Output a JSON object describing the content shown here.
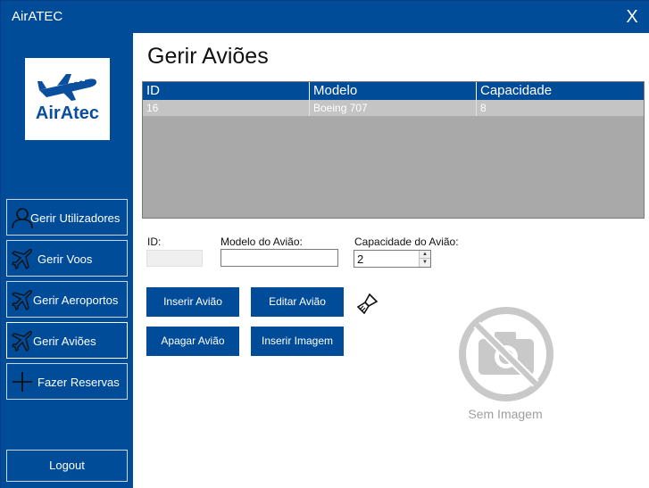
{
  "window": {
    "title": "AirATEC",
    "close_glyph": "X"
  },
  "logo": {
    "text": "AirAtec",
    "icon": "airplane-icon"
  },
  "sidebar": {
    "items": [
      {
        "label": "Gerir Utilizadores",
        "icon": "user-icon"
      },
      {
        "label": "Gerir Voos",
        "icon": "airplane-icon"
      },
      {
        "label": "Gerir Aeroportos",
        "icon": "airplane-icon"
      },
      {
        "label": "Gerir Aviões",
        "icon": "airplane-icon",
        "active": true
      },
      {
        "label": "Fazer Reservas",
        "icon": "plus-icon"
      }
    ],
    "logout_label": "Logout"
  },
  "main": {
    "title": "Gerir Aviões",
    "grid": {
      "columns": [
        "ID",
        "Modelo",
        "Capacidade"
      ],
      "rows": [
        [
          "16",
          "Boeing 707",
          "8"
        ]
      ]
    },
    "form": {
      "id_label": "ID:",
      "id_value": "",
      "model_label": "Modelo do Avião:",
      "model_value": "",
      "capacity_label": "Capacidade do Avião:",
      "capacity_value": "2"
    },
    "buttons": {
      "insert": "Inserir Avião",
      "edit": "Editar Avião",
      "delete": "Apagar Avião",
      "insert_image": "Inserir Imagem"
    },
    "image_placeholder": {
      "label": "Sem Imagem",
      "icon": "no-camera-icon"
    }
  },
  "colors": {
    "primary": "#004c99",
    "grid_bg": "#a9a9a9",
    "selected_row": "#c4c4c4",
    "muted_text": "#9e9e9e"
  }
}
